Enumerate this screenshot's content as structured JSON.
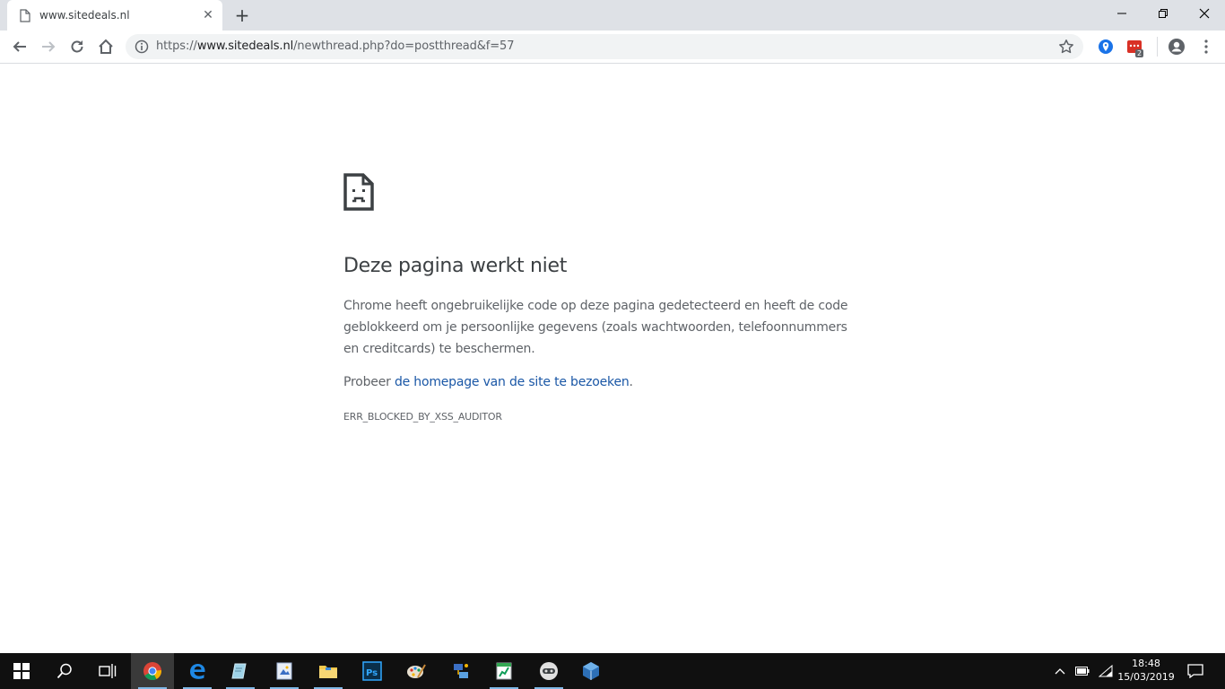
{
  "tab": {
    "title": "www.sitedeals.nl",
    "favicon": "page-icon",
    "close_icon": "close-icon"
  },
  "toolbar": {
    "url_scheme": "https://",
    "url_host": "www.sitedeals.nl",
    "url_path": "/newthread.php?do=postthread&f=57",
    "extension_badge": "2"
  },
  "error_page": {
    "icon": "sad-page-icon",
    "heading": "Deze pagina werkt niet",
    "body": "Chrome heeft ongebruikelijke code op deze pagina gedetecteerd en heeft de code geblokkeerd om je persoonlijke gegevens (zoals wachtwoorden, telefoonnummers en creditcards) te beschermen.",
    "suggest_prefix": "Probeer ",
    "suggest_link": "de homepage van de site te bezoeken",
    "suggest_suffix": ".",
    "error_code": "ERR_BLOCKED_BY_XSS_AUDITOR",
    "link_color": "#1a57a6"
  },
  "taskbar": {
    "time": "18:48",
    "date": "15/03/2019",
    "apps": [
      "start-icon",
      "search-icon",
      "task-view-icon",
      "chrome-icon",
      "edge-icon",
      "notepad-icon",
      "document-viewer-icon",
      "file-explorer-icon",
      "photoshop-icon",
      "paint-icon",
      "network-tool-icon",
      "spreadsheet-icon",
      "vpn-icon",
      "virtualbox-icon"
    ]
  },
  "colors": {
    "tabstrip": "#dee1e6",
    "taskbar": "#101010",
    "accent_blue": "#1a73e8"
  }
}
